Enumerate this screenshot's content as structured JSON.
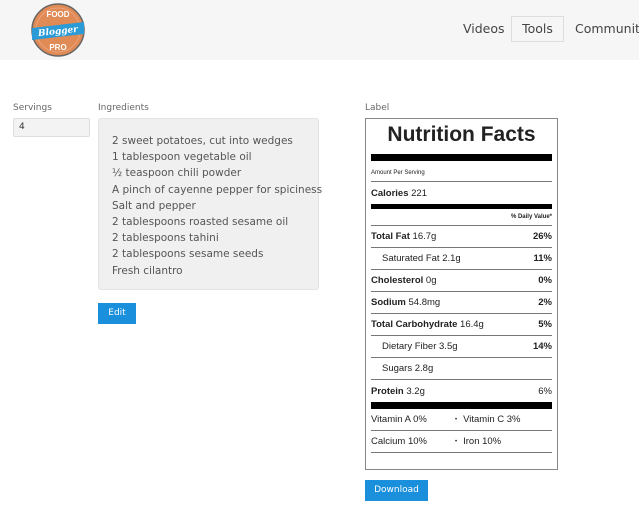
{
  "header": {
    "logo": {
      "line1": "FOOD",
      "line2": "Blogger",
      "line3": "PRO"
    },
    "nav": [
      {
        "label": "Videos",
        "active": false
      },
      {
        "label": "Tools",
        "active": true
      },
      {
        "label": "Community",
        "active": false
      }
    ]
  },
  "form": {
    "servings_label": "Servings",
    "servings_value": "4",
    "ingredients_label": "Ingredients",
    "ingredients": [
      "2 sweet potatoes, cut into wedges",
      "1 tablespoon vegetable oil",
      "½ teaspoon chili powder",
      "A pinch of cayenne pepper for spiciness",
      "Salt and pepper",
      "2 tablespoons roasted sesame oil",
      "2 tablespoons tahini",
      "2 tablespoons sesame seeds",
      "Fresh cilantro"
    ],
    "edit_label": "Edit"
  },
  "label": {
    "section_label": "Label",
    "title": "Nutrition Facts",
    "amount_per_serving": "Amount Per Serving",
    "calories_label": "Calories",
    "calories_value": "221",
    "daily_value_header": "% Daily Value*",
    "rows": [
      {
        "name": "Total Fat",
        "amount": "16.7g",
        "dv": "26%"
      },
      {
        "name": "Saturated Fat",
        "amount": "2.1g",
        "dv": "11%"
      },
      {
        "name": "Cholesterol",
        "amount": "0g",
        "dv": "0%"
      },
      {
        "name": "Sodium",
        "amount": "54.8mg",
        "dv": "2%"
      },
      {
        "name": "Total Carbohydrate",
        "amount": "16.4g",
        "dv": "5%"
      },
      {
        "name": "Dietary Fiber",
        "amount": "3.5g",
        "dv": "14%"
      },
      {
        "name": "Sugars",
        "amount": "2.8g",
        "dv": ""
      },
      {
        "name": "Protein",
        "amount": "3.2g",
        "dv": "6%"
      }
    ],
    "vitamins": [
      [
        "Vitamin A 0%",
        "Vitamin C 3%"
      ],
      [
        "Calcium 10%",
        "Iron 10%"
      ]
    ],
    "bullet": "•",
    "download_label": "Download"
  },
  "colors": {
    "accent": "#1a8fdb",
    "logo_orange": "#e08a55",
    "logo_blue": "#2a9bd6"
  }
}
